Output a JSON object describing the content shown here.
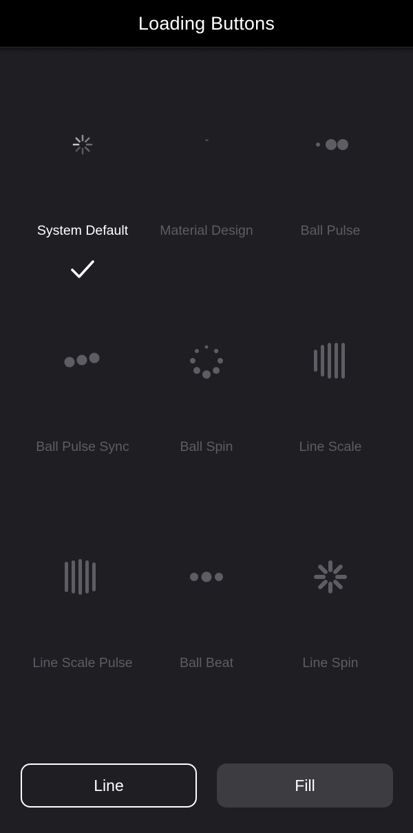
{
  "header": {
    "title": "Loading Buttons"
  },
  "indicators": [
    {
      "label": "System Default",
      "icon": "system-default-spinner-icon",
      "selected": true
    },
    {
      "label": "Material Design",
      "icon": "material-design-spinner-icon",
      "selected": false
    },
    {
      "label": "Ball Pulse",
      "icon": "ball-pulse-icon",
      "selected": false
    },
    {
      "label": "Ball Pulse Sync",
      "icon": "ball-pulse-sync-icon",
      "selected": false
    },
    {
      "label": "Ball Spin",
      "icon": "ball-spin-icon",
      "selected": false
    },
    {
      "label": "Line Scale",
      "icon": "line-scale-icon",
      "selected": false
    },
    {
      "label": "Line Scale Pulse",
      "icon": "line-scale-pulse-icon",
      "selected": false
    },
    {
      "label": "Ball Beat",
      "icon": "ball-beat-icon",
      "selected": false
    },
    {
      "label": "Line Spin",
      "icon": "line-spin-icon",
      "selected": false
    }
  ],
  "buttons": {
    "line_label": "Line",
    "fill_label": "Fill"
  },
  "colors": {
    "background": "#1f1e22",
    "header": "#000000",
    "indicator": "#5e5d63",
    "selected_text": "#ffffff",
    "fill_button": "#3c3c41"
  }
}
